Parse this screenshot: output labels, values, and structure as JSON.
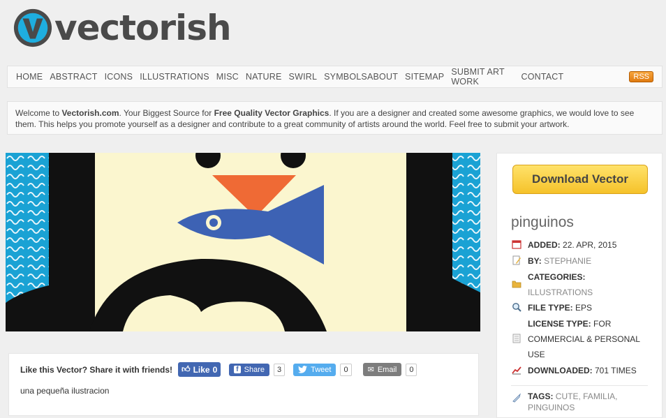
{
  "brand": {
    "name": "vectorish"
  },
  "nav": {
    "left": [
      "HOME",
      "ABSTRACT",
      "ICONS",
      "ILLUSTRATIONS",
      "MISC",
      "NATURE",
      "SWIRL",
      "SYMBOLS"
    ],
    "right": [
      "ABOUT",
      "SITEMAP",
      "SUBMIT ART WORK",
      "CONTACT"
    ],
    "rss": "RSS"
  },
  "welcome": {
    "t1": "Welcome to ",
    "site": "Vectorish.com",
    "t2": ". Your Biggest Source for ",
    "bold": "Free Quality Vector Graphics",
    "t3": ". If you are a designer and created some awesome graphics, we would love to see them. This helps you promote yourself as a designer and contribute to a great community of artists around the world. Feel free to submit your artwork."
  },
  "share": {
    "label": "Like this Vector? Share it with friends!",
    "like": "Like",
    "like_count": "0",
    "facebook": "Share",
    "facebook_count": "3",
    "tweet": "Tweet",
    "tweet_count": "0",
    "email": "Email",
    "email_count": "0"
  },
  "description": "una pequeña ilustracion",
  "sidebar": {
    "download": "Download Vector",
    "title": "pinguinos",
    "added_key": "ADDED:",
    "added": "22. APR, 2015",
    "by_key": "BY:",
    "by": "STEPHANIE",
    "categories_key": "CATEGORIES:",
    "categories": "ILLUSTRATIONS",
    "filetype_key": "FILE TYPE:",
    "filetype": "EPS",
    "license_key": "LICENSE TYPE:",
    "license": "FOR COMMERCIAL & PERSONAL USE",
    "downloaded_key": "DOWNLOADED:",
    "downloaded": "701 TIMES",
    "tags_key": "TAGS:",
    "tags": [
      "CUTE",
      "FAMILIA",
      "PINGUINOS"
    ]
  },
  "colors": {
    "background": "#efefef",
    "wave_blue": "#1aa2d4",
    "penguin_body": "#fbf6cf",
    "beak": "#ef6a35",
    "fish": "#3d62b4",
    "download_yellow": "#f5c22a"
  },
  "icons": [
    "v-logo-icon",
    "calendar-icon",
    "pencil-icon",
    "folder-icon",
    "magnifier-icon",
    "document-icon",
    "chart-icon",
    "tag-icon",
    "thumbs-up-icon",
    "facebook-icon",
    "twitter-icon",
    "mail-icon"
  ]
}
